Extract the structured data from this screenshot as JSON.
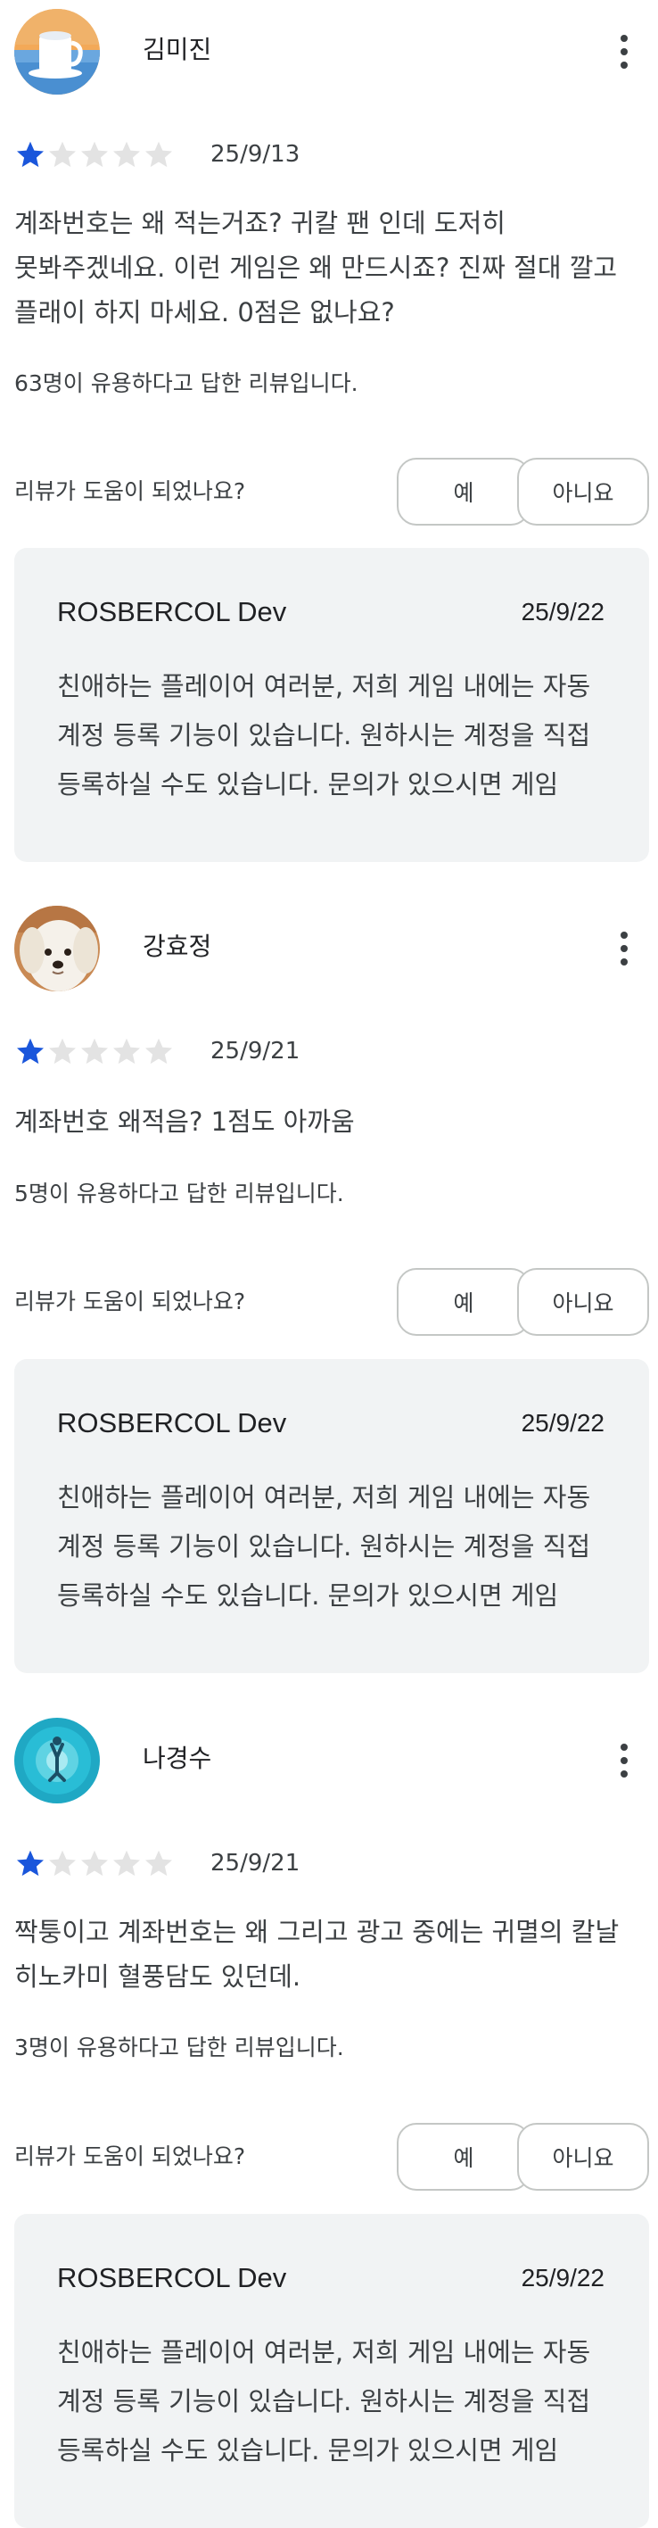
{
  "reviews": [
    {
      "name": "김미진",
      "avatar": "coffee-cup-avatar",
      "rating": 1,
      "max_rating": 5,
      "date": "25/9/13",
      "text_lines": [
        "계좌번호는 왜 적는거죠? 귀칼 팬 인데 도저히",
        "못봐주겠네요. 이런 게임은 왜 만드시죠? 진짜 절대 깔고",
        "플래이 하지 마세요. 0점은 없나요?"
      ],
      "helpful_count": "63명이 유용하다고 답한 리뷰입니다.",
      "helpful_question": "리뷰가 도움이 되었나요?",
      "yes_label": "예",
      "no_label": "아니요",
      "reply": {
        "developer": "ROSBERCOL Dev",
        "date": "25/9/22",
        "text_lines": [
          "친애하는 플레이어 여러분, 저희 게임 내에는 자동",
          "계정 등록 기능이 있습니다. 원하시는 계정을 직접",
          "등록하실 수도 있습니다. 문의가 있으시면 게임"
        ]
      }
    },
    {
      "name": "강효정",
      "avatar": "puppy-avatar",
      "rating": 1,
      "max_rating": 5,
      "date": "25/9/21",
      "text_lines": [
        "계좌번호 왜적음? 1점도 아까움"
      ],
      "helpful_count": "5명이 유용하다고 답한 리뷰입니다.",
      "helpful_question": "리뷰가 도움이 되었나요?",
      "yes_label": "예",
      "no_label": "아니요",
      "reply": {
        "developer": "ROSBERCOL Dev",
        "date": "25/9/22",
        "text_lines": [
          "친애하는 플레이어 여러분, 저희 게임 내에는 자동",
          "계정 등록 기능이 있습니다. 원하시는 계정을 직접",
          "등록하실 수도 있습니다. 문의가 있으시면 게임"
        ]
      }
    },
    {
      "name": "나경수",
      "avatar": "underwater-swimmer-avatar",
      "rating": 1,
      "max_rating": 5,
      "date": "25/9/21",
      "text_lines": [
        "짝퉁이고 계좌번호는 왜 그리고 광고 중에는 귀멸의 칼날",
        "히노카미 혈풍담도 있던데."
      ],
      "helpful_count": "3명이 유용하다고 답한 리뷰입니다.",
      "helpful_question": "리뷰가 도움이 되었나요?",
      "yes_label": "예",
      "no_label": "아니요",
      "reply": {
        "developer": "ROSBERCOL Dev",
        "date": "25/9/22",
        "text_lines": [
          "친애하는 플레이어 여러분, 저희 게임 내에는 자동",
          "계정 등록 기능이 있습니다. 원하시는 계정을 직접",
          "등록하실 수도 있습니다. 문의가 있으시면 게임"
        ]
      }
    }
  ],
  "colors": {
    "star_filled": "#1a56db",
    "star_empty": "#e3e3e3",
    "reply_bg": "#f1f3f4",
    "button_border": "#c4c7c5"
  }
}
